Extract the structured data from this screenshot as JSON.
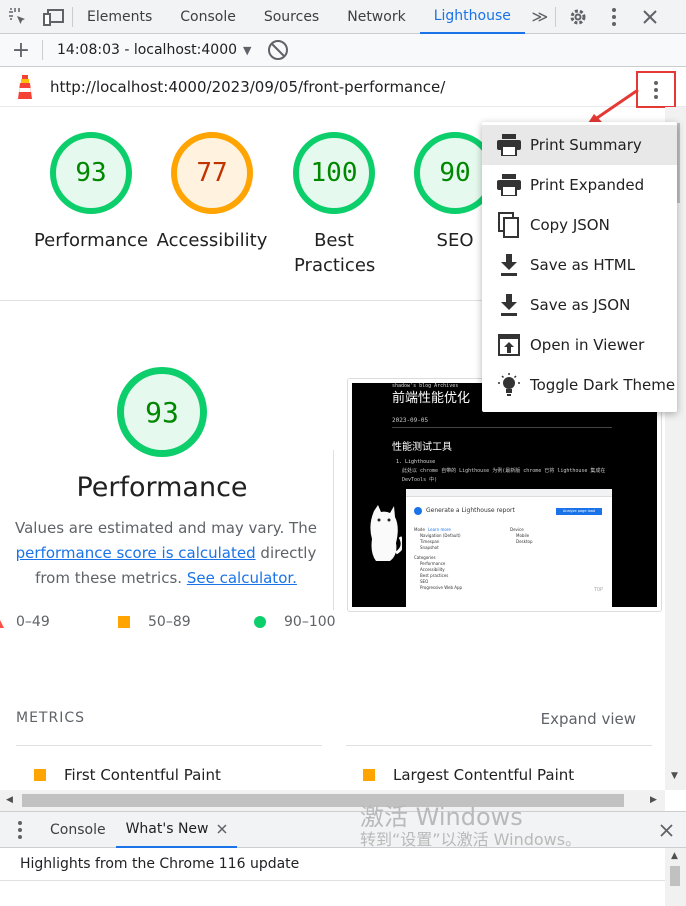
{
  "devtools": {
    "tabs": [
      {
        "label": "Elements"
      },
      {
        "label": "Console"
      },
      {
        "label": "Sources"
      },
      {
        "label": "Network"
      },
      {
        "label": "Lighthouse",
        "active": true
      }
    ],
    "more_tabs": "≫"
  },
  "toolbar": {
    "report_label": "14:08:03 - localhost:4000",
    "report_caret": "▼"
  },
  "url": {
    "text": "http://localhost:4000/2023/09/05/front-performance/"
  },
  "scores": [
    {
      "value": "93",
      "label": "Performance",
      "rating": "good"
    },
    {
      "value": "77",
      "label": "Accessibility",
      "rating": "average"
    },
    {
      "value": "100",
      "label": "Best Practices",
      "rating": "good"
    },
    {
      "value": "90",
      "label": "SEO",
      "rating": "good"
    }
  ],
  "performance": {
    "score": "93",
    "title": "Performance",
    "desc_prefix": "Values are estimated and may vary. The",
    "desc_link": "performance score is calculated",
    "desc_middle": "directly from these metrics.",
    "desc_link2": "See calculator."
  },
  "legend": {
    "fail": "0–49",
    "average": "50–89",
    "pass": "90–100"
  },
  "screenshot": {
    "nav": "shadow's blog  Archives",
    "title": "前端性能优化",
    "date": "2023-09-05",
    "heading": "性能测试工具",
    "list_item": "1. Lighthouse",
    "list_text": "此处以 chrome 自带的 Lighthouse 为例(最新版 chrome 已将 lighthouse 集成在 DevTools 中)",
    "panel_title": "Generate a Lighthouse report",
    "panel_button": "Analyze page load",
    "mode_label": "Mode",
    "learn_more": "Learn more",
    "modes": [
      "Navigation (Default)",
      "Timespan",
      "Snapshot"
    ],
    "device_label": "Device",
    "devices": [
      "Mobile",
      "Desktop"
    ],
    "categories_label": "Categories",
    "categories": [
      "Performance",
      "Accessibility",
      "Best practices",
      "SEO",
      "Progressive Web App"
    ],
    "top_label": "TOP"
  },
  "metrics": {
    "title": "METRICS",
    "expand": "Expand view",
    "items": [
      "First Contentful Paint",
      "Largest Contentful Paint"
    ]
  },
  "menu": {
    "items": [
      {
        "label": "Print Summary",
        "icon": "print-icon"
      },
      {
        "label": "Print Expanded",
        "icon": "print-icon"
      },
      {
        "label": "Copy JSON",
        "icon": "copy-icon"
      },
      {
        "label": "Save as HTML",
        "icon": "download-icon"
      },
      {
        "label": "Save as JSON",
        "icon": "download-icon"
      },
      {
        "label": "Open in Viewer",
        "icon": "open-in-viewer-icon"
      },
      {
        "label": "Toggle Dark Theme",
        "icon": "lightbulb-icon"
      }
    ]
  },
  "drawer": {
    "tabs": [
      "Console",
      "What's New"
    ],
    "highlights": "Highlights from the Chrome 116 update"
  },
  "watermark": {
    "line1": "激活 Windows",
    "line2": "转到“设置”以激活 Windows。"
  },
  "colors": {
    "good": "#0cce6b",
    "average": "#ffa400",
    "accent": "#1a73e8",
    "annotation": "#e53935"
  }
}
